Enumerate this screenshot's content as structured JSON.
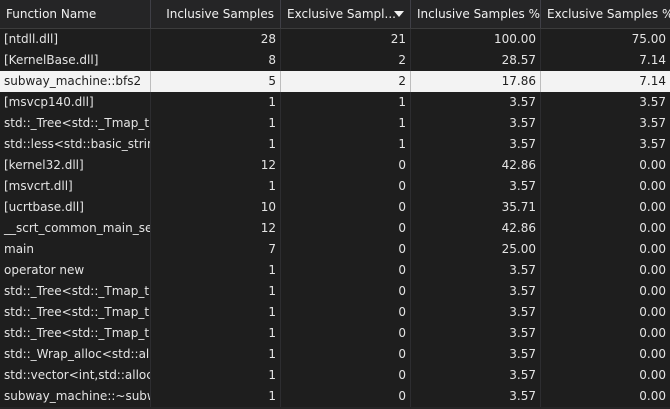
{
  "columns": [
    {
      "label": "Function Name",
      "align": "left"
    },
    {
      "label": "Inclusive Samples",
      "align": "right"
    },
    {
      "label": "Exclusive Sampl...",
      "align": "right",
      "sorted": "desc"
    },
    {
      "label": "Inclusive Samples %",
      "align": "right"
    },
    {
      "label": "Exclusive Samples %",
      "align": "right"
    }
  ],
  "sort_icon": "sort-descending-icon",
  "selected_row": 2,
  "rows": [
    {
      "name": "[ntdll.dll]",
      "incl": "28",
      "excl": "21",
      "incl_pct": "100.00",
      "excl_pct": "75.00"
    },
    {
      "name": "[KernelBase.dll]",
      "incl": "8",
      "excl": "2",
      "incl_pct": "28.57",
      "excl_pct": "7.14"
    },
    {
      "name": "subway_machine::bfs2",
      "incl": "5",
      "excl": "2",
      "incl_pct": "17.86",
      "excl_pct": "7.14"
    },
    {
      "name": "[msvcp140.dll]",
      "incl": "1",
      "excl": "1",
      "incl_pct": "3.57",
      "excl_pct": "3.57"
    },
    {
      "name": "std::_Tree<std::_Tmap_tra",
      "incl": "1",
      "excl": "1",
      "incl_pct": "3.57",
      "excl_pct": "3.57"
    },
    {
      "name": "std::less<std::basic_string",
      "incl": "1",
      "excl": "1",
      "incl_pct": "3.57",
      "excl_pct": "3.57"
    },
    {
      "name": "[kernel32.dll]",
      "incl": "12",
      "excl": "0",
      "incl_pct": "42.86",
      "excl_pct": "0.00"
    },
    {
      "name": "[msvcrt.dll]",
      "incl": "1",
      "excl": "0",
      "incl_pct": "3.57",
      "excl_pct": "0.00"
    },
    {
      "name": "[ucrtbase.dll]",
      "incl": "10",
      "excl": "0",
      "incl_pct": "35.71",
      "excl_pct": "0.00"
    },
    {
      "name": "__scrt_common_main_seh",
      "incl": "12",
      "excl": "0",
      "incl_pct": "42.86",
      "excl_pct": "0.00"
    },
    {
      "name": "main",
      "incl": "7",
      "excl": "0",
      "incl_pct": "25.00",
      "excl_pct": "0.00"
    },
    {
      "name": "operator new",
      "incl": "1",
      "excl": "0",
      "incl_pct": "3.57",
      "excl_pct": "0.00"
    },
    {
      "name": "std::_Tree<std::_Tmap_tra",
      "incl": "1",
      "excl": "0",
      "incl_pct": "3.57",
      "excl_pct": "0.00"
    },
    {
      "name": "std::_Tree<std::_Tmap_tra",
      "incl": "1",
      "excl": "0",
      "incl_pct": "3.57",
      "excl_pct": "0.00"
    },
    {
      "name": "std::_Tree<std::_Tmap_tra",
      "incl": "1",
      "excl": "0",
      "incl_pct": "3.57",
      "excl_pct": "0.00"
    },
    {
      "name": "std::_Wrap_alloc<std::allo",
      "incl": "1",
      "excl": "0",
      "incl_pct": "3.57",
      "excl_pct": "0.00"
    },
    {
      "name": "std::vector<int,std::allocat",
      "incl": "1",
      "excl": "0",
      "incl_pct": "3.57",
      "excl_pct": "0.00"
    },
    {
      "name": "subway_machine::~subwa",
      "incl": "1",
      "excl": "0",
      "incl_pct": "3.57",
      "excl_pct": "0.00"
    }
  ]
}
